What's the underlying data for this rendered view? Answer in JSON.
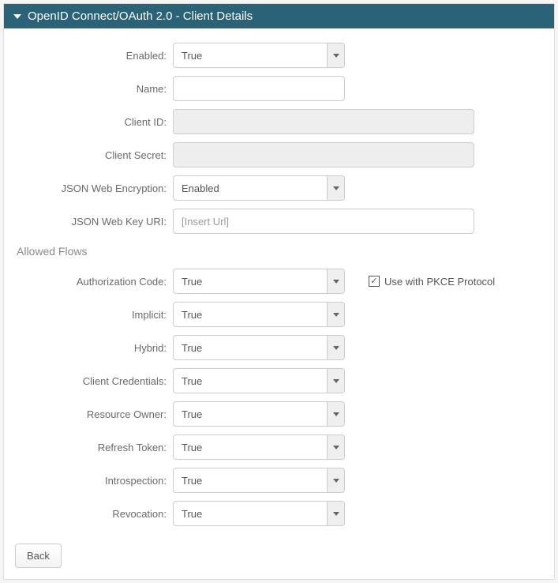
{
  "header": {
    "title": "OpenID Connect/OAuth 2.0 - Client Details"
  },
  "fields": {
    "enabled": {
      "label": "Enabled:",
      "value": "True"
    },
    "name": {
      "label": "Name:",
      "value": ""
    },
    "client_id": {
      "label": "Client ID:",
      "value": ""
    },
    "client_secret": {
      "label": "Client Secret:",
      "value": ""
    },
    "jwe": {
      "label": "JSON Web Encryption:",
      "value": "Enabled"
    },
    "jwk_uri": {
      "label": "JSON Web Key URI:",
      "placeholder": "[Insert Url]",
      "value": ""
    }
  },
  "flows": {
    "section_label": "Allowed Flows",
    "auth_code": {
      "label": "Authorization Code:",
      "value": "True"
    },
    "pkce": {
      "label": "Use with PKCE Protocol",
      "checked": true
    },
    "implicit": {
      "label": "Implicit:",
      "value": "True"
    },
    "hybrid": {
      "label": "Hybrid:",
      "value": "True"
    },
    "client_credentials": {
      "label": "Client Credentials:",
      "value": "True"
    },
    "resource_owner": {
      "label": "Resource Owner:",
      "value": "True"
    },
    "refresh_token": {
      "label": "Refresh Token:",
      "value": "True"
    },
    "introspection": {
      "label": "Introspection:",
      "value": "True"
    },
    "revocation": {
      "label": "Revocation:",
      "value": "True"
    }
  },
  "buttons": {
    "back": "Back"
  }
}
